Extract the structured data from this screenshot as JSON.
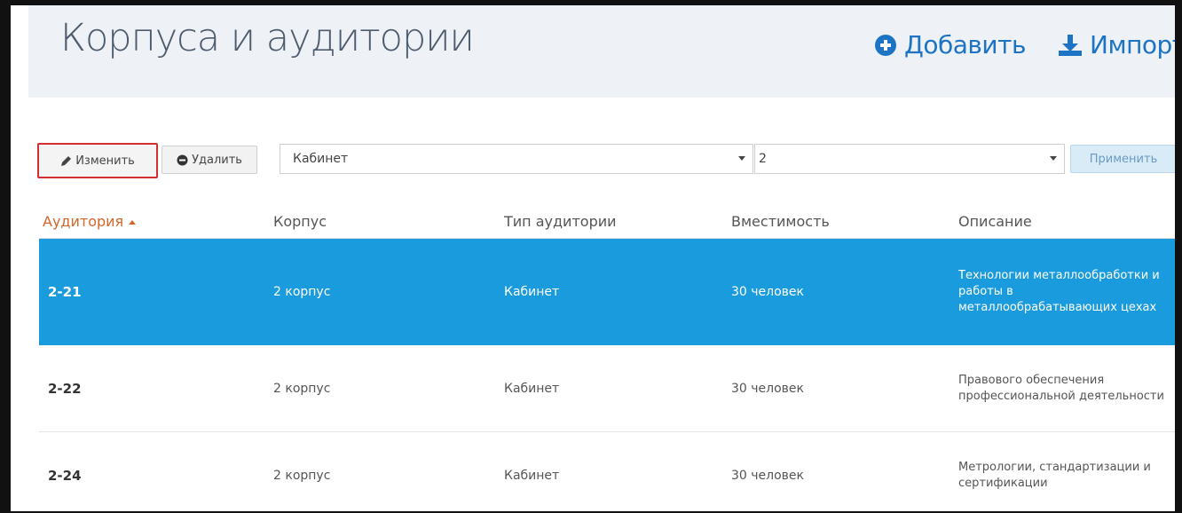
{
  "header": {
    "title": "Корпуса и аудитории",
    "add_label": "Добавить",
    "import_label": "Импорт"
  },
  "toolbar": {
    "edit_label": "Изменить",
    "delete_label": "Удалить",
    "type_select_value": "Кабинет",
    "number_select_value": "2",
    "apply_label": "Применить"
  },
  "table": {
    "columns": [
      "Аудитория",
      "Корпус",
      "Тип аудитории",
      "Вместимость",
      "Описание"
    ],
    "sorted_column": "Аудитория",
    "rows": [
      {
        "room": "2-21",
        "building": "2 корпус",
        "type": "Кабинет",
        "capacity": "30 человек",
        "description": "Технологии металлообработки и работы в металлообрабатывающих цехах",
        "selected": true
      },
      {
        "room": "2-22",
        "building": "2 корпус",
        "type": "Кабинет",
        "capacity": "30 человек",
        "description": "Правового обеспечения профессиональной деятельности",
        "selected": false
      },
      {
        "room": "2-24",
        "building": "2 корпус",
        "type": "Кабинет",
        "capacity": "30 человек",
        "description": "Метрологии, стандартизации и сертификации",
        "selected": false
      }
    ]
  },
  "colors": {
    "selected_row": "#1a9bde",
    "accent_link": "#1d74c4",
    "sorted_header": "#d4662a",
    "edit_highlight": "#d32f2f"
  },
  "icons": {
    "add": "plus-circle-icon",
    "import": "download-icon",
    "edit": "pencil-icon",
    "delete": "minus-circle-icon"
  }
}
